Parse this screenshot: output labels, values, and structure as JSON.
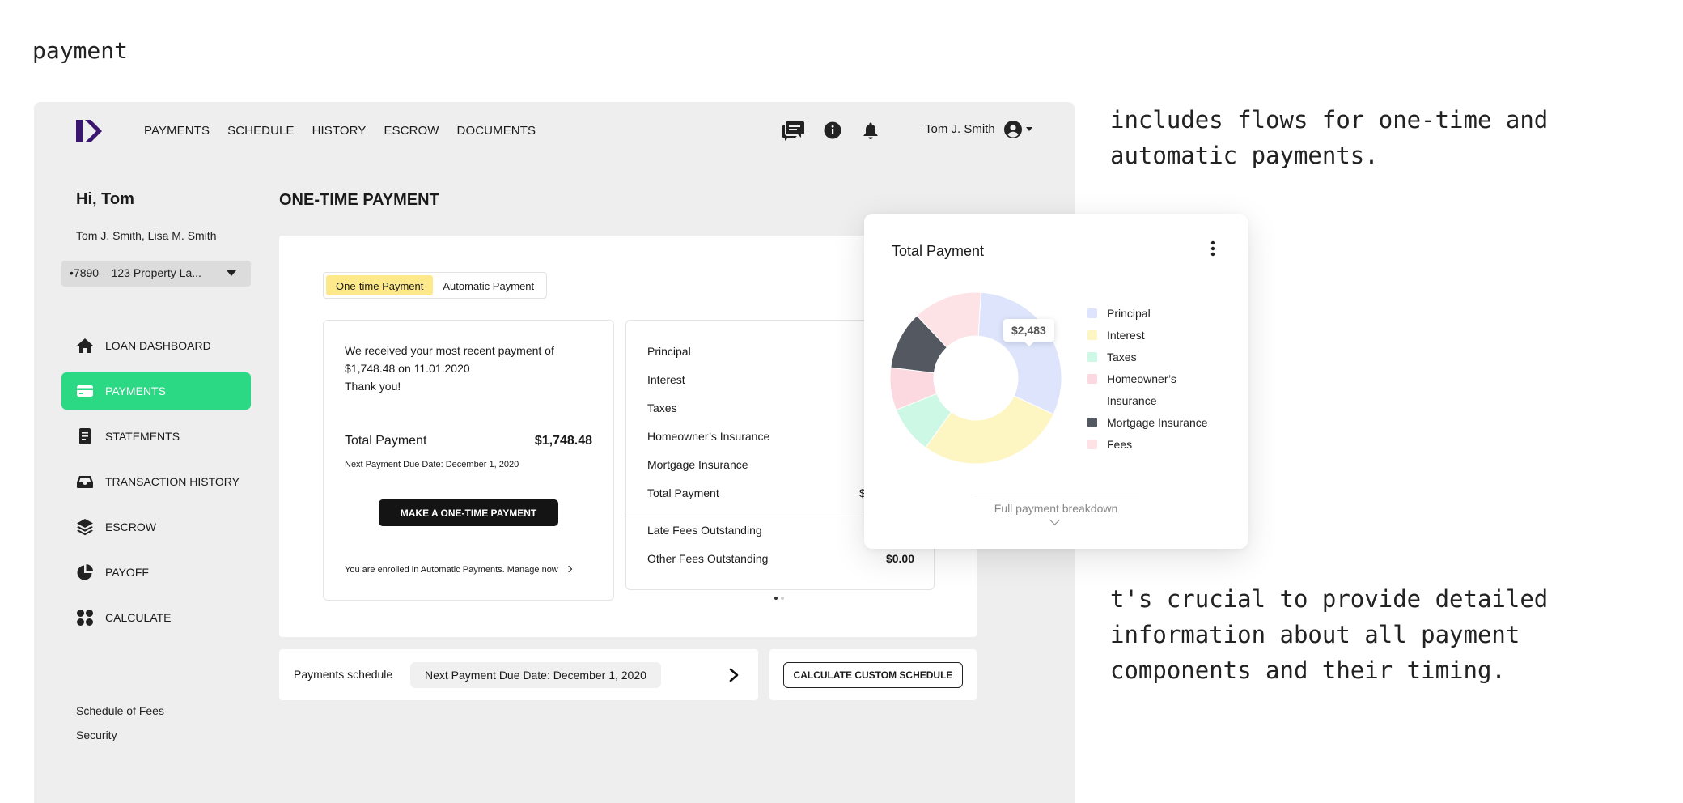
{
  "page_label": "payment",
  "notes": {
    "top": "includes flows for one-time and automatic payments.",
    "bottom": "t's crucial to provide detailed information about all payment components and their timing."
  },
  "header": {
    "nav": [
      "PAYMENTS",
      "SCHEDULE",
      "HISTORY",
      "ESCROW",
      "DOCUMENTS"
    ],
    "icons": [
      "chat-icon",
      "info-icon",
      "bell-icon"
    ],
    "user_name": "Tom J. Smith"
  },
  "sidebar": {
    "greeting": "Hi, Tom",
    "names": "Tom J. Smith, Lisa M. Smith",
    "loan_selector": "•7890 – 123 Property La...",
    "items": [
      {
        "label": "LOAN DASHBOARD",
        "icon": "home-icon"
      },
      {
        "label": "PAYMENTS",
        "icon": "card-icon"
      },
      {
        "label": "STATEMENTS",
        "icon": "document-icon"
      },
      {
        "label": "TRANSACTION HISTORY",
        "icon": "inbox-icon"
      },
      {
        "label": "ESCROW",
        "icon": "layers-icon"
      },
      {
        "label": "PAYOFF",
        "icon": "pie-icon"
      },
      {
        "label": "CALCULATE",
        "icon": "dots-grid-icon"
      }
    ],
    "footer_links": [
      "Schedule of Fees",
      "Security"
    ]
  },
  "main": {
    "title": "ONE-TIME PAYMENT",
    "toggle": {
      "one_time": "One-time Payment",
      "automatic": "Automatic Payment",
      "selected": "One-time Payment"
    },
    "recent": {
      "message": "We received your most recent payment of $1,748.48 on 11.01.2020",
      "thanks": "Thank you!",
      "total_label": "Total Payment",
      "total_value": "$1,748.48",
      "next_due": "Next Payment Due Date: December 1, 2020",
      "button": "MAKE A ONE-TIME PAYMENT",
      "enrolled": "You are enrolled in Automatic Payments. Manage now"
    },
    "breakdown": {
      "rows": [
        {
          "label": "Principal",
          "value": ""
        },
        {
          "label": "Interest",
          "value": ""
        },
        {
          "label": "Taxes",
          "value": ""
        },
        {
          "label": "Homeowner’s Insurance",
          "value": ""
        },
        {
          "label": "Mortgage Insurance",
          "value": ""
        },
        {
          "label": "Total Payment",
          "value": "$"
        }
      ],
      "outstanding": [
        {
          "label": "Late Fees Outstanding",
          "value": ""
        },
        {
          "label": "Other Fees Outstanding",
          "value": "$0.00"
        }
      ]
    },
    "schedule": {
      "label": "Payments schedule",
      "next_due": "Next Payment Due Date: December 1, 2020",
      "calc_button": "CALCULATE CUSTOM SCHEDULE"
    }
  },
  "popup": {
    "title": "Total Payment",
    "tooltip": "$2,483",
    "footer_link": "Full payment breakdown"
  },
  "chart_data": {
    "type": "pie",
    "categories": [
      "Principal",
      "Interest",
      "Taxes",
      "Homeowner’s Insurance",
      "Mortgage Insurance",
      "Fees"
    ],
    "values": [
      31,
      28,
      9,
      8,
      11,
      13
    ],
    "colors": [
      "#dde4fb",
      "#fdf5c2",
      "#cdf8e6",
      "#fcd9e1",
      "#545861",
      "#fde3e6"
    ],
    "legend_labels": [
      "Principal",
      "Interest",
      "Taxes",
      "Homeowner’s",
      "Insurance",
      "Mortgage Insurance",
      "Fees"
    ],
    "legend_placement": "right",
    "title": "Total Payment"
  }
}
